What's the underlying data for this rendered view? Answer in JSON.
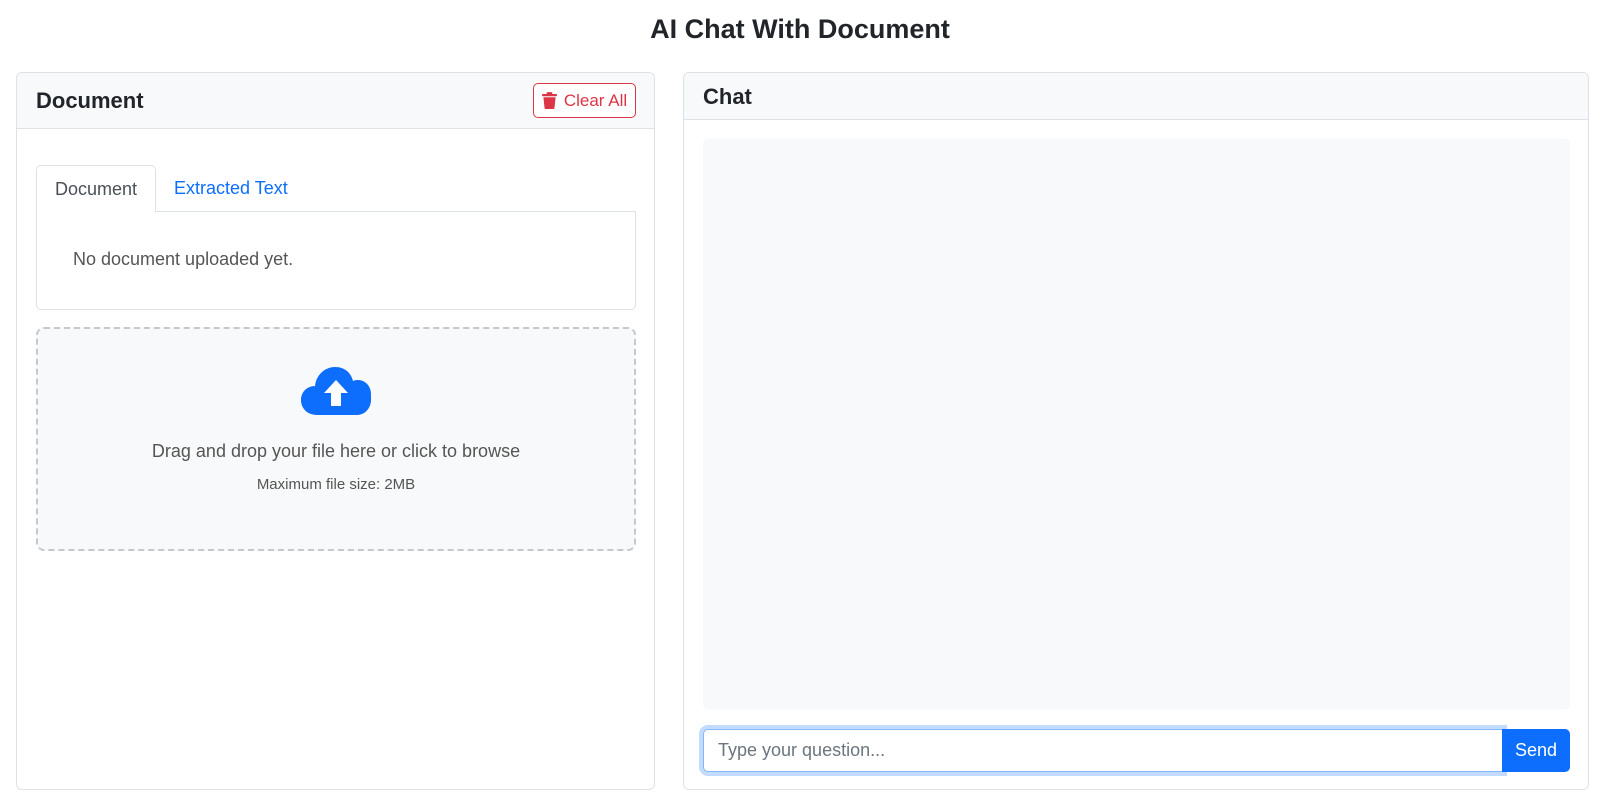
{
  "page": {
    "title": "AI Chat With Document"
  },
  "document_panel": {
    "title": "Document",
    "clear_button": {
      "label": "Clear All",
      "icon": "trash-icon",
      "color": "#dc3545"
    },
    "tabs": [
      {
        "label": "Document",
        "active": true
      },
      {
        "label": "Extracted Text",
        "active": false
      }
    ],
    "empty_message": "No document uploaded yet.",
    "dropzone": {
      "icon": "cloud-upload-icon",
      "text": "Drag and drop your file here or click to browse",
      "subtext": "Maximum file size: 2MB"
    }
  },
  "chat_panel": {
    "title": "Chat",
    "input": {
      "value": "",
      "placeholder": "Type your question..."
    },
    "send_button": {
      "label": "Send"
    }
  },
  "colors": {
    "primary": "#0d6efd",
    "danger": "#dc3545",
    "muted_bg": "#f8f9fa"
  }
}
